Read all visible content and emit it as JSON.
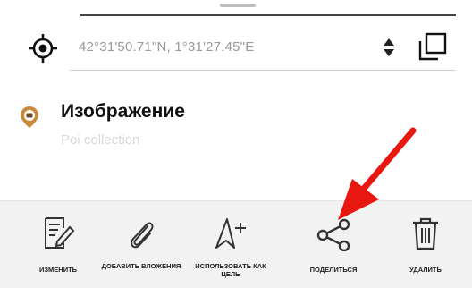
{
  "coordinates": {
    "value": "42°31'50.71\"N, 1°31'27.45\"E"
  },
  "poi": {
    "title": "Изображение",
    "subtitle": "Poi collection"
  },
  "actions": [
    {
      "label": "ИЗМЕНИТЬ",
      "icon": "edit-icon"
    },
    {
      "label": "ДОБАВИТЬ ВЛОЖЕНИЯ",
      "icon": "paperclip-icon"
    },
    {
      "label": "ИСПОЛЬЗОВАТЬ КАК ЦЕЛЬ",
      "icon": "navigate-target-icon"
    },
    {
      "label": "ПОДЕЛИТЬСЯ",
      "icon": "share-icon"
    },
    {
      "label": "УДАЛИТЬ",
      "icon": "trash-icon"
    }
  ],
  "colors": {
    "annotation_arrow": "#e8170f",
    "poi_marker": "#c98a3a",
    "action_bar_bg": "#f2f2f2"
  }
}
